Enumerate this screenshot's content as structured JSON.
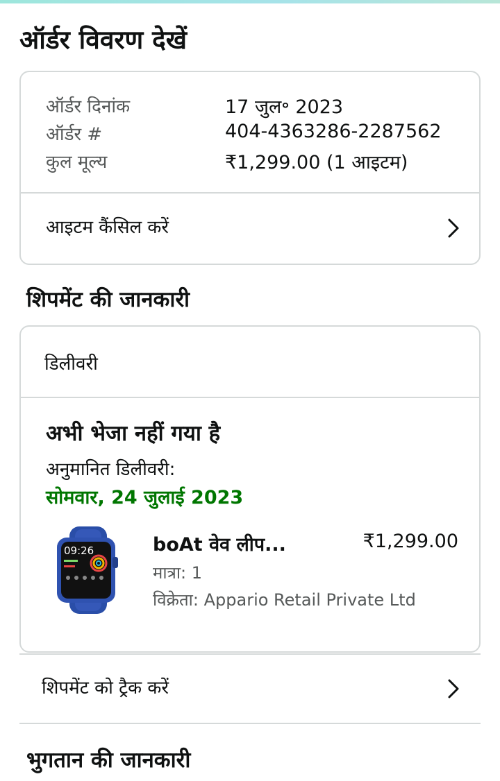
{
  "page": {
    "title": "ऑर्डर विवरण देखें"
  },
  "order": {
    "date_label": "ऑर्डर दिनांक",
    "date_value": "17 जुल॰ 2023",
    "number_label": "ऑर्डर #",
    "number_value": "404-4363286-2287562",
    "total_label": "कुल मूल्य",
    "total_value": "₹1,299.00 (1 आइटम)",
    "cancel_label": "आइटम कैंसिल करें"
  },
  "shipment": {
    "section_title": "शिपमेंट की जानकारी",
    "delivery_label": "डिलीवरी",
    "status": "अभी भेजा नहीं गया है",
    "estimated_label": "अनुमानित डिलीवरी:",
    "estimated_date": "सोमवार, 24 जुलाई 2023",
    "item": {
      "title": "boAt वेव लीप...",
      "price": "₹1,299.00",
      "quantity": "मात्रा: 1",
      "seller": "विक्रेता: Appario Retail Private Ltd",
      "watch_time": "09:26",
      "image_icon": "smartwatch-icon"
    },
    "track_label": "शिपमेंट को ट्रैक करें"
  },
  "payment": {
    "section_title": "भुगतान की जानकारी"
  },
  "colors": {
    "accent_green": "#007600",
    "border": "#d5d9d9",
    "text": "#0f1111",
    "muted": "#565959",
    "watch_strap": "#2a4ea8"
  }
}
